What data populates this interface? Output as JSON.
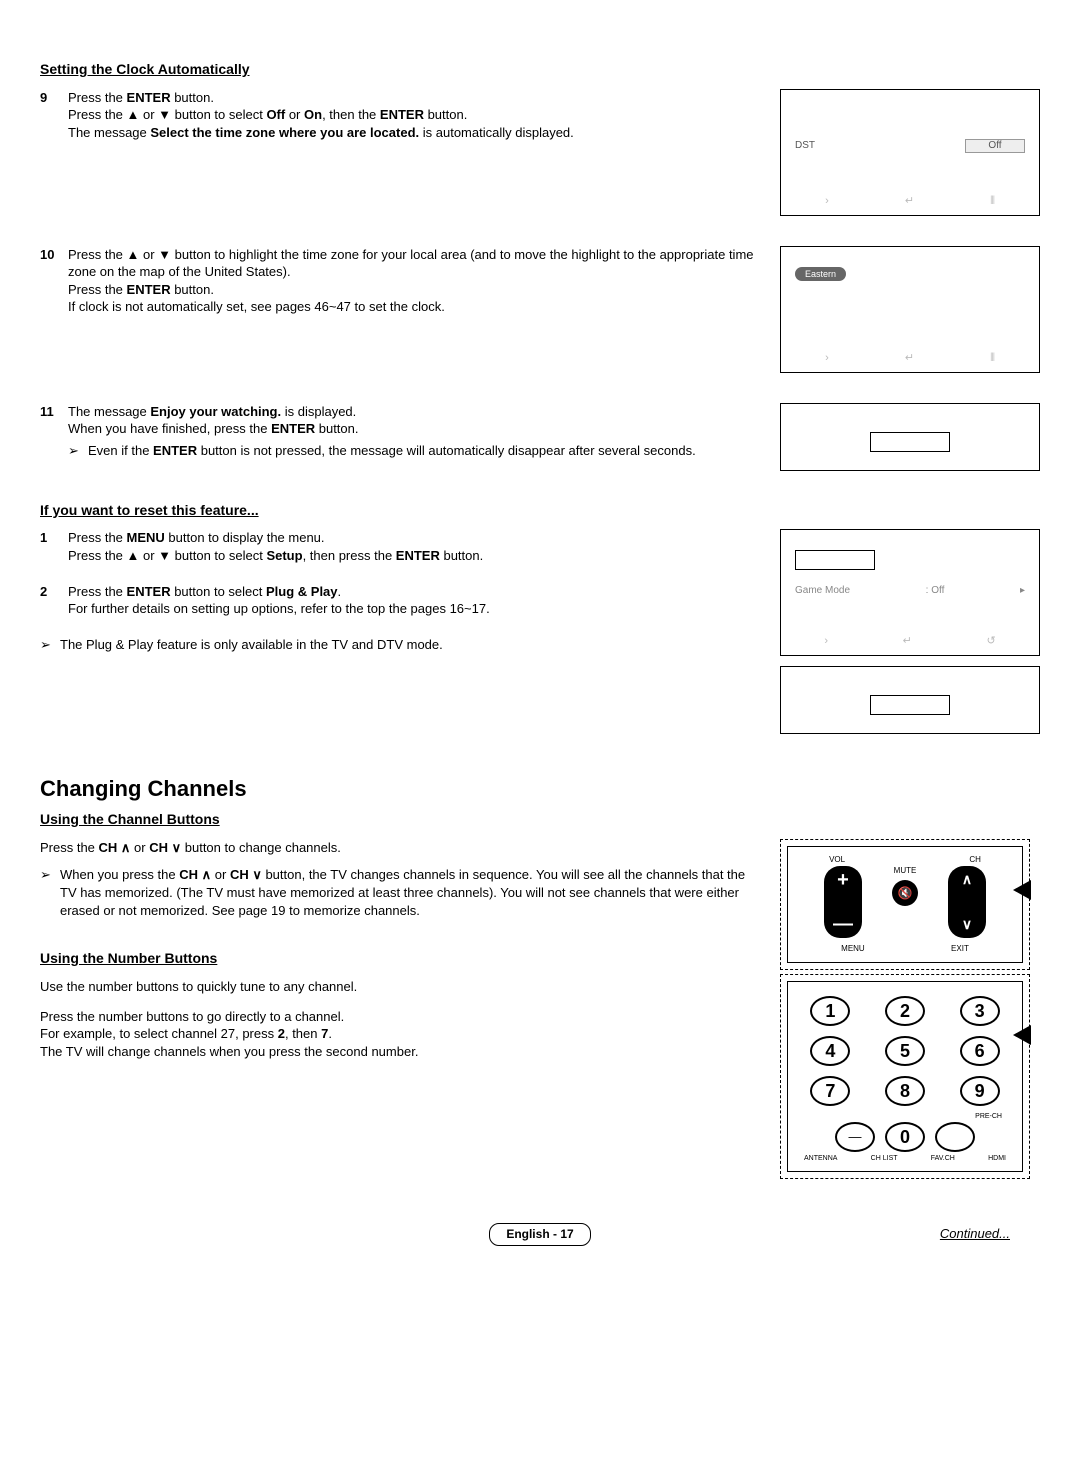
{
  "clockSection": {
    "heading": "Setting the Clock Automatically",
    "step9": {
      "num": "9",
      "line1a": "Press the ",
      "line1b": "ENTER",
      "line1c": " button.",
      "line2a": "Press the ▲ or ▼ button to select ",
      "line2b": "Off",
      "line2c": " or ",
      "line2d": "On",
      "line2e": ", then the ",
      "line2f": "ENTER",
      "line2g": " button.",
      "line3a": "The message ",
      "line3b": "Select the time zone where you are located.",
      "line3c": " is automatically displayed."
    },
    "step10": {
      "num": "10",
      "line1": "Press the ▲ or ▼ button to highlight the time zone for your local area (and to move the highlight to the appropriate time zone on the map of the United States).",
      "line2a": "Press the ",
      "line2b": "ENTER",
      "line2c": " button.",
      "line3": "If clock is not automatically set, see pages 46~47 to set the clock."
    },
    "step11": {
      "num": "11",
      "line1a": "The message ",
      "line1b": "Enjoy your watching.",
      "line1c": " is displayed.",
      "line2a": "When you have finished, press the ",
      "line2b": "ENTER",
      "line2c": " button.",
      "notea": "Even if the ",
      "noteb": "ENTER",
      "notec": " button is not pressed, the message will automatically disappear after several seconds."
    },
    "osd1": {
      "label": "DST",
      "value": "Off"
    },
    "osd2": {
      "label": "Eastern"
    }
  },
  "resetSection": {
    "heading": "If you want to reset this feature...",
    "step1": {
      "num": "1",
      "line1a": "Press the ",
      "line1b": "MENU",
      "line1c": " button to display the menu.",
      "line2a": "Press the ▲ or ▼ button to select ",
      "line2b": "Setup",
      "line2c": ", then press the ",
      "line2d": "ENTER",
      "line2e": " button."
    },
    "step2": {
      "num": "2",
      "line1a": "Press the ",
      "line1b": "ENTER",
      "line1c": " button to select ",
      "line1d": "Plug & Play",
      "line1e": ".",
      "line2": "For further details on setting up options, refer to the top the pages 16~17."
    },
    "note": "The Plug & Play feature is only available in the TV and DTV mode.",
    "osd": {
      "label": "Game Mode",
      "value": ": Off",
      "arrow": "▸"
    }
  },
  "channelsSection": {
    "heading": "Changing Channels",
    "sub1": "Using the Channel Buttons",
    "line1a": "Press the ",
    "line1b": "CH ",
    "line1c": " or ",
    "line1d": "CH ",
    "line1e": " button to change channels.",
    "note1a": "When you press the ",
    "note1b": "CH ",
    "note1c": " or ",
    "note1d": "CH ",
    "note1e": " button, the TV changes channels in sequence. You will see all the channels that the TV has memorized. (The TV must have memorized at least three channels). You will not see channels that were either erased or not memorized. See page 19 to memorize channels.",
    "sub2": "Using the Number Buttons",
    "line2": "Use the number buttons to quickly tune to any channel.",
    "line3a": "Press the number buttons to go directly to a channel.",
    "line3b": "For example, to select channel 27, press ",
    "line3c": "2",
    "line3d": ", then ",
    "line3e": "7",
    "line3f": ".",
    "line3g": "The TV will change channels when you press the second number."
  },
  "remote": {
    "vol": "VOL",
    "ch": "CH",
    "mute": "MUTE",
    "menu": "MENU",
    "exit": "EXIT",
    "numbers": [
      "1",
      "2",
      "3",
      "4",
      "5",
      "6",
      "7",
      "8",
      "9"
    ],
    "zero": "0",
    "dash": "—",
    "prech": "PRE-CH",
    "bottomLabels": [
      "ANTENNA",
      "CH LIST",
      "FAV.CH",
      "HDMI"
    ]
  },
  "footer": {
    "page": "English - 17",
    "continued": "Continued..."
  },
  "icons": {
    "move": "›",
    "enter": "↵",
    "skip": "⫴",
    "return": "↺",
    "arrowNote": "➢",
    "chevUp": "∧",
    "chevDown": "∨",
    "muteGlyph": "🔇"
  }
}
